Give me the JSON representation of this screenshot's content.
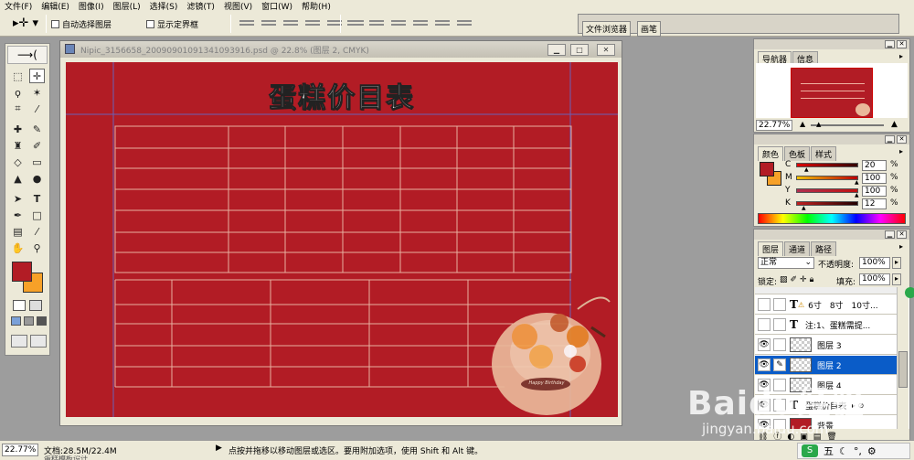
{
  "menu": [
    "文件(F)",
    "编辑(E)",
    "图像(I)",
    "图层(L)",
    "选择(S)",
    "滤镜(T)",
    "视图(V)",
    "窗口(W)",
    "帮助(H)"
  ],
  "options": {
    "auto_select": "自动选择图层",
    "show_bounds": "显示定界框",
    "tab_browser": "文件浏览器",
    "tab_brush": "画笔"
  },
  "document": {
    "title": "Nipic_3156658_20090901091341093916.psd @ 22.8% (图层 2, CMYK)",
    "heading": "蛋糕价目表",
    "watermark_text": "Happy Birthday"
  },
  "status": {
    "zoom": "22.77%",
    "doc_size": "文档:28.5M/22.4M",
    "hint": "点按并拖移以移动图层或选区。要用附加选项，使用 Shift 和 Alt 键。",
    "bottom_cut": "蛋糕模板设计"
  },
  "navigator": {
    "tabs": [
      "导航器",
      "信息"
    ],
    "zoom": "22.77%"
  },
  "color": {
    "tabs": [
      "颜色",
      "色板",
      "样式"
    ],
    "channels": [
      {
        "label": "C",
        "value": "20",
        "unit": "%"
      },
      {
        "label": "M",
        "value": "100",
        "unit": "%"
      },
      {
        "label": "Y",
        "value": "100",
        "unit": "%"
      },
      {
        "label": "K",
        "value": "12",
        "unit": "%"
      }
    ],
    "foreground": "#b21c25",
    "background": "#f7a128"
  },
  "layers": {
    "tabs": [
      "图层",
      "通道",
      "路径"
    ],
    "blend_mode": "正常",
    "opacity_label": "不透明度:",
    "opacity": "100%",
    "lock_label": "锁定:",
    "fill_label": "填充:",
    "fill": "100%",
    "items": [
      {
        "name": "6寸　8寸　10寸...",
        "kind": "text",
        "warn": true,
        "eye": false
      },
      {
        "name": "注:1、蛋糕需提...",
        "kind": "text",
        "warn": false,
        "eye": false
      },
      {
        "name": "图层 3",
        "kind": "raster",
        "eye": true
      },
      {
        "name": "图层 2",
        "kind": "raster",
        "eye": true,
        "selected": true
      },
      {
        "name": "图层 4",
        "kind": "raster",
        "eye": true
      },
      {
        "name": "蛋糕价目表",
        "kind": "text",
        "eye": true
      },
      {
        "name": "背景",
        "kind": "bg",
        "eye": true
      }
    ]
  },
  "overlay": {
    "brand": "Baidu经验",
    "url": "jingyan.baidu.com",
    "ime": "五"
  }
}
